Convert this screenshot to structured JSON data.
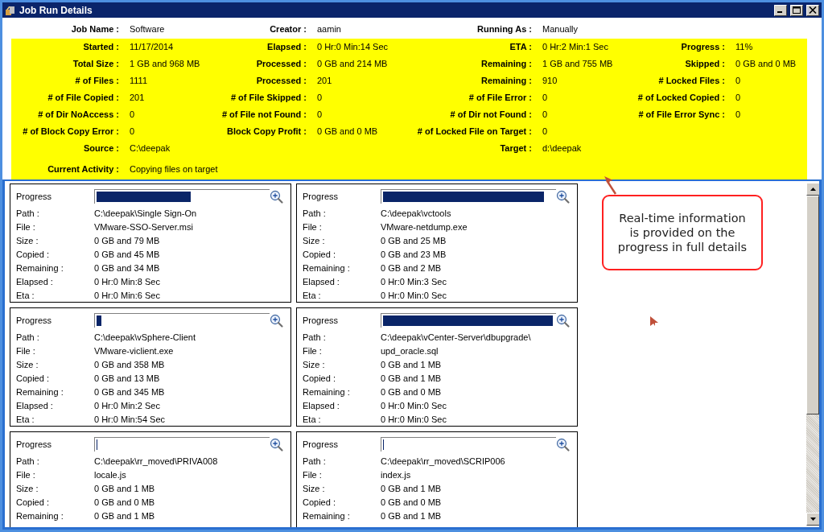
{
  "window": {
    "title": "Job Run Details"
  },
  "job_info": {
    "col_1": {
      "label": "Job Name :",
      "value": "Software"
    },
    "col_2": {
      "label": "Creator :",
      "value": "aamin"
    },
    "col_3": {
      "label": "Running As :",
      "value": "Manually"
    }
  },
  "stats": [
    {
      "col_1": {
        "label": "Started :",
        "value": "11/17/2014"
      },
      "col_2": {
        "label": "Elapsed :",
        "value": "0 Hr:0 Min:14 Sec"
      },
      "col_3": {
        "label": "ETA :",
        "value": "0 Hr:2 Min:1 Sec"
      },
      "col_4": {
        "label": "Progress :",
        "value": "11%"
      }
    },
    {
      "col_1": {
        "label": "Total Size :",
        "value": "1 GB and 968 MB"
      },
      "col_2": {
        "label": "Processed :",
        "value": "0 GB and 214 MB"
      },
      "col_3": {
        "label": "Remaining :",
        "value": "1 GB and 755 MB"
      },
      "col_4": {
        "label": "Skipped :",
        "value": "0 GB and 0 MB"
      }
    },
    {
      "col_1": {
        "label": "# of Files :",
        "value": "1111"
      },
      "col_2": {
        "label": "Processed :",
        "value": "201"
      },
      "col_3": {
        "label": "Remaining :",
        "value": "910"
      },
      "col_4": {
        "label": "# Locked Files :",
        "value": "0"
      }
    },
    {
      "col_1": {
        "label": "# of File Copied :",
        "value": "201"
      },
      "col_2": {
        "label": "# of File Skipped :",
        "value": "0"
      },
      "col_3": {
        "label": "# of File Error :",
        "value": "0"
      },
      "col_4": {
        "label": "# of Locked Copied :",
        "value": "0"
      }
    },
    {
      "col_1": {
        "label": "# of Dir NoAccess :",
        "value": "0"
      },
      "col_2": {
        "label": "# of File not Found :",
        "value": "0"
      },
      "col_3": {
        "label": "# of Dir not Found :",
        "value": "0"
      },
      "col_4": {
        "label": "# of File Error Sync :",
        "value": "0"
      }
    },
    {
      "col_1": {
        "label": "# of Block Copy Error :",
        "value": "0"
      },
      "col_2": {
        "label": "Block Copy Profit :",
        "value": "0 GB and 0 MB"
      },
      "col_3": {
        "label": "# of Locked File on Target :",
        "value": "0"
      }
    },
    {
      "col_1": {
        "label": "Source :",
        "value": "C:\\deepak"
      },
      "col_3": {
        "label": "Target :",
        "value": "d:\\deepak"
      }
    },
    {
      "col_1": {
        "label": "Current Activity :",
        "value": "Copying files on target"
      }
    }
  ],
  "cards": [
    {
      "progress_label": "Progress",
      "level": 0.55,
      "fields": [
        {
          "label": "Path :",
          "value": "C:\\deepak\\Single Sign-On"
        },
        {
          "label": "File :",
          "value": "VMware-SSO-Server.msi"
        },
        {
          "label": "Size :",
          "value": "0 GB and 79 MB"
        },
        {
          "label": "Copied :",
          "value": "0 GB and 45 MB"
        },
        {
          "label": "Remaining :",
          "value": "0 GB and 34 MB"
        },
        {
          "label": "Elapsed :",
          "value": "0 Hr:0 Min:8 Sec"
        },
        {
          "label": "Eta :",
          "value": "0 Hr:0 Min:6 Sec"
        }
      ]
    },
    {
      "progress_label": "Progress",
      "level": 0.94,
      "fields": [
        {
          "label": "Path :",
          "value": "C:\\deepak\\vctools"
        },
        {
          "label": "File :",
          "value": "VMware-netdump.exe"
        },
        {
          "label": "Size :",
          "value": "0 GB and 25 MB"
        },
        {
          "label": "Copied :",
          "value": "0 GB and 23 MB"
        },
        {
          "label": "Remaining :",
          "value": "0 GB and 2 MB"
        },
        {
          "label": "Elapsed :",
          "value": "0 Hr:0 Min:3 Sec"
        },
        {
          "label": "Eta :",
          "value": "0 Hr:0 Min:0 Sec"
        }
      ]
    },
    {
      "progress_label": "Progress",
      "level": 0.03,
      "fields": [
        {
          "label": "Path :",
          "value": "C:\\deepak\\vSphere-Client"
        },
        {
          "label": "File :",
          "value": "VMware-viclient.exe"
        },
        {
          "label": "Size :",
          "value": "0 GB and 358 MB"
        },
        {
          "label": "Copied :",
          "value": "0 GB and 13 MB"
        },
        {
          "label": "Remaining :",
          "value": "0 GB and 345 MB"
        },
        {
          "label": "Elapsed :",
          "value": "0 Hr:0 Min:2 Sec"
        },
        {
          "label": "Eta :",
          "value": "0 Hr:0 Min:54 Sec"
        }
      ]
    },
    {
      "progress_label": "Progress",
      "level": 0.99,
      "fields": [
        {
          "label": "Path :",
          "value": "C:\\deepak\\vCenter-Server\\dbupgrade\\"
        },
        {
          "label": "File :",
          "value": "upd_oracle.sql"
        },
        {
          "label": "Size :",
          "value": "0 GB and 1 MB"
        },
        {
          "label": "Copied :",
          "value": "0 GB and 1 MB"
        },
        {
          "label": "Remaining :",
          "value": "0 GB and 0 MB"
        },
        {
          "label": "Elapsed :",
          "value": "0 Hr:0 Min:0 Sec"
        },
        {
          "label": "Eta :",
          "value": "0 Hr:0 Min:0 Sec"
        }
      ]
    },
    {
      "progress_label": "Progress",
      "level": 0,
      "fields": [
        {
          "label": "Path :",
          "value": "C:\\deepak\\rr_moved\\PRIVA008"
        },
        {
          "label": "File :",
          "value": "locale.js"
        },
        {
          "label": "Size :",
          "value": "0 GB and 1 MB"
        },
        {
          "label": "Copied :",
          "value": "0 GB and 0 MB"
        },
        {
          "label": "Remaining :",
          "value": "0 GB and 1 MB"
        }
      ]
    },
    {
      "progress_label": "Progress",
      "level": 0,
      "fields": [
        {
          "label": "Path :",
          "value": "C:\\deepak\\rr_moved\\SCRIP006"
        },
        {
          "label": "File :",
          "value": "index.js"
        },
        {
          "label": "Size :",
          "value": "0 GB and 1 MB"
        },
        {
          "label": "Copied :",
          "value": "0 GB and 0 MB"
        },
        {
          "label": "Remaining :",
          "value": "0 GB and 1 MB"
        }
      ]
    }
  ],
  "callout": {
    "lines": [
      "Real-time information",
      "is provided on the",
      "progress in full details"
    ]
  }
}
